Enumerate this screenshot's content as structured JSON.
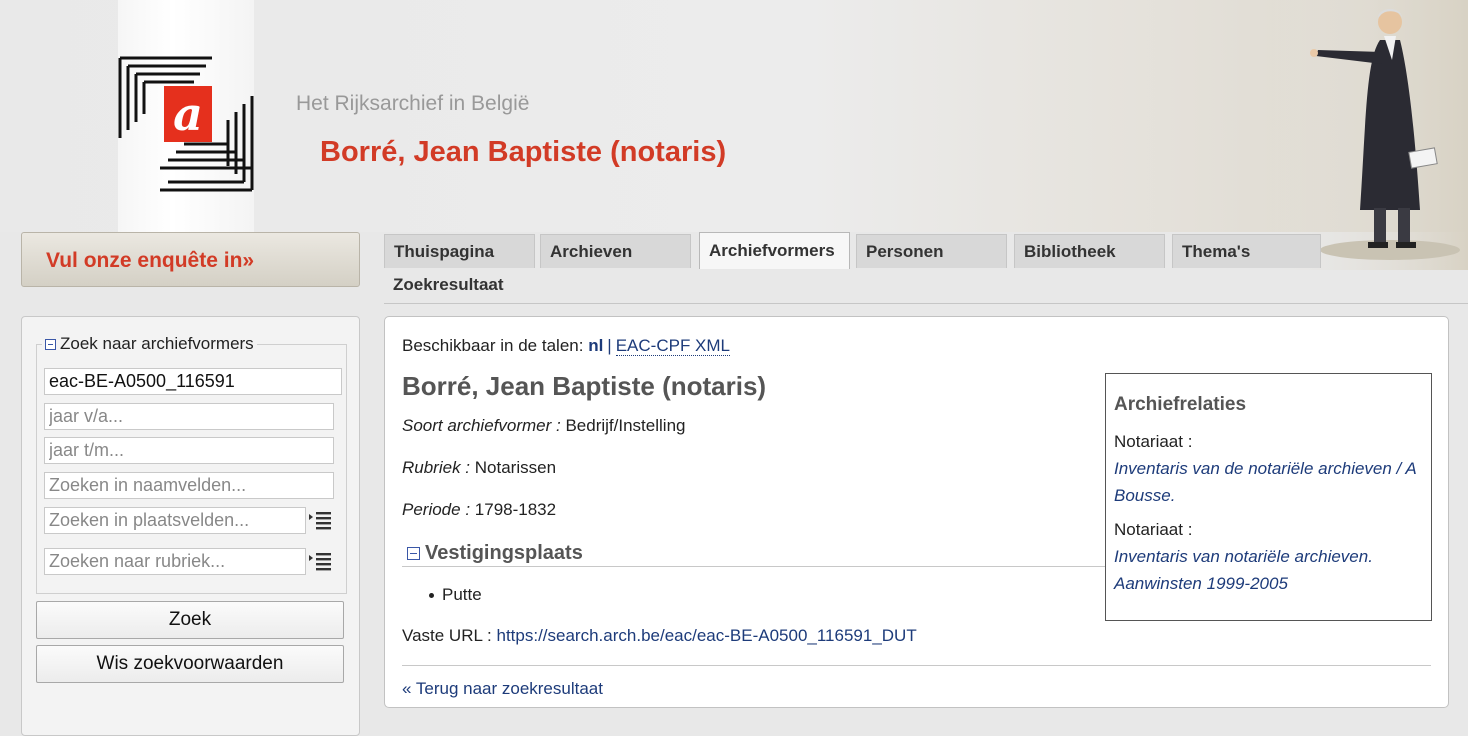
{
  "header": {
    "site_name": "Het Rijksarchief in België",
    "page_heading": "Borré, Jean Baptiste (notaris)",
    "logo_letter": "a"
  },
  "survey": {
    "label": "Vul onze enquête in»"
  },
  "search": {
    "legend": "Zoek naar archiefvormers",
    "id_value": "eac-BE-A0500_116591",
    "year_from_placeholder": "jaar v/a...",
    "year_to_placeholder": "jaar t/m...",
    "name_placeholder": "Zoeken in naamvelden...",
    "place_placeholder": "Zoeken in plaatsvelden...",
    "rubric_placeholder": "Zoeken naar rubriek...",
    "search_button": "Zoek",
    "clear_button": "Wis zoekvoorwaarden"
  },
  "tabs": [
    {
      "label": "Thuispagina",
      "active": false
    },
    {
      "label": "Archieven",
      "active": false
    },
    {
      "label": "Archiefvormers",
      "active": true
    },
    {
      "label": "Personen",
      "active": false
    },
    {
      "label": "Bibliotheek",
      "active": false
    },
    {
      "label": "Thema's",
      "active": false
    }
  ],
  "subnav": {
    "label": "Zoekresultaat"
  },
  "record": {
    "languages_label": "Beschikbaar in de talen:",
    "language_current": "nl",
    "language_sep": "|",
    "xml_link": "EAC-CPF XML",
    "title": "Borré, Jean Baptiste (notaris)",
    "fields": [
      {
        "label": "Soort archiefvormer :",
        "value": "Bedrijf/Instelling"
      },
      {
        "label": "Rubriek :",
        "value": "Notarissen"
      },
      {
        "label": "Periode :",
        "value": "1798-1832"
      }
    ],
    "section_heading": "Vestigingsplaats",
    "places": [
      "Putte"
    ],
    "url_label": "Vaste URL :",
    "url": "https://search.arch.be/eac/eac-BE-A0500_116591_DUT",
    "back_link": "« Terug naar zoekresultaat"
  },
  "relations": {
    "title": "Archiefrelaties",
    "items": [
      {
        "label": "Notariaat :",
        "link": "Inventaris van de notariële archieven / A Bousse."
      },
      {
        "label": "Notariaat :",
        "link": "Inventaris van notariële archieven. Aanwinsten 1999-2005"
      }
    ]
  },
  "colors": {
    "accent_red": "#d23b26",
    "link_blue": "#1d3b7a",
    "background": "#e8e8e8"
  },
  "icons": [
    "logo-icon",
    "collapse-icon",
    "list-menu-icon",
    "portrait-image"
  ]
}
